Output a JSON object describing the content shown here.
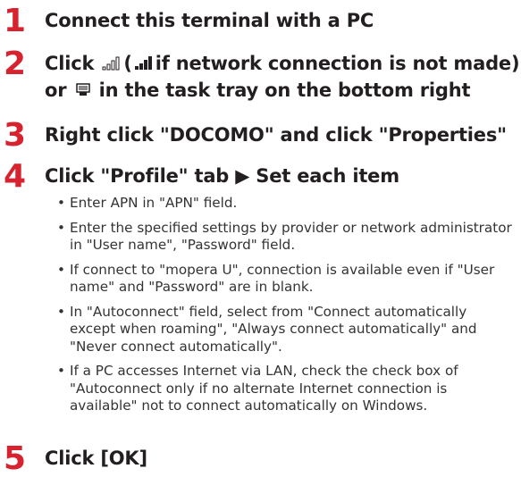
{
  "accent_color": "#d7232f",
  "steps": [
    {
      "number": "1",
      "title": "Connect this terminal with a PC"
    },
    {
      "number": "2",
      "title_line1_a": "Click",
      "title_line1_b": "(",
      "title_line1_c": "if network connection is not made)",
      "title_line2_a": "or",
      "title_line2_b": "in the task tray on the bottom right",
      "icons": [
        "signal-icon",
        "signal-no-connection-icon",
        "device-icon"
      ]
    },
    {
      "number": "3",
      "title": "Right click \"DOCOMO\" and click \"Properties\""
    },
    {
      "number": "4",
      "title": "Click \"Profile\" tab ▶ Set each item",
      "bullets": [
        "Enter APN in \"APN\" field.",
        "Enter the specified settings by provider or network administrator in \"User name\", \"Password\" field.",
        "If connect to \"mopera U\", connection is available even if \"User name\" and \"Password\" are in blank.",
        "In \"Autoconnect\" field, select from \"Connect automatically except when roaming\", \"Always connect automatically\" and \"Never connect automatically\".",
        "If a PC accesses Internet via LAN, check the check box of \"Autoconnect only if no alternate Internet connection is available\" not to connect automatically on Windows."
      ]
    },
    {
      "number": "5",
      "title": "Click [OK]"
    }
  ]
}
